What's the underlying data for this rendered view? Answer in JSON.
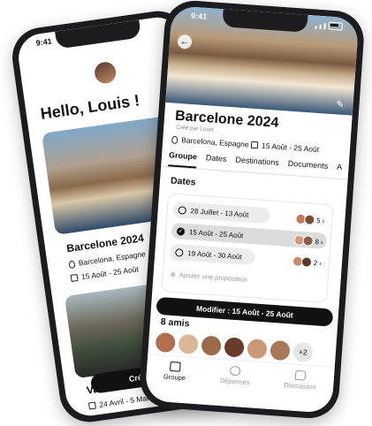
{
  "back_phone": {
    "status_time": "9:41",
    "greeting": "Hello, Louis !",
    "cards": [
      {
        "title": "Barcelone 2024",
        "location": "Barcelona, Espagne",
        "dates": "15 Août - 25 Août"
      },
      {
        "title": "Vacances à",
        "dates": "24 Avril - 5 Mai"
      }
    ],
    "create_label": "Créer"
  },
  "front_phone": {
    "status_time": "9:41",
    "trip_title": "Barcelone 2024",
    "creator": "Créé par Louis",
    "location": "Barcelona, Espagne",
    "dates": "15 Août - 25 Août",
    "tabs": [
      "Groupe",
      "Dates",
      "Destinations",
      "Documents",
      "A"
    ],
    "dates_heading": "Dates",
    "date_options": [
      {
        "label": "28 Juillet - 13 Août",
        "count": "5",
        "selected": false
      },
      {
        "label": "15 Août - 25 Août",
        "count": "8",
        "selected": true
      },
      {
        "label": "19 Août - 30 Août",
        "count": "2",
        "selected": false
      }
    ],
    "add_proposal": "Ajouter une proposition",
    "modify_label": "Modifier : 15 Août - 25 Août",
    "friends_heading": "8 amis",
    "friends_more": "+2",
    "nav": [
      "Groupe",
      "Dépenses",
      "Discussion"
    ]
  }
}
